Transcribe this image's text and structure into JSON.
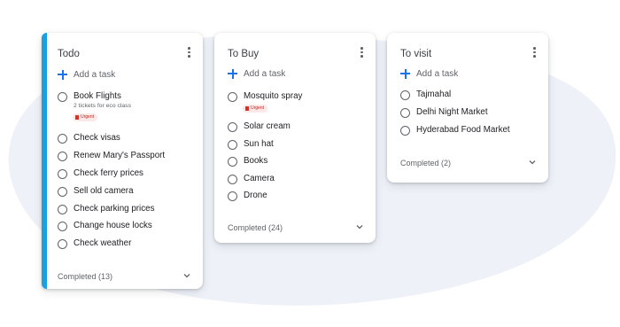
{
  "colors": {
    "accent_bar": "#1a9fe0",
    "add_icon": "#1a73e8",
    "urgent_chip_bg": "#fce8e6",
    "urgent_chip_text": "#c5221f",
    "background_blob": "#eef1f8"
  },
  "icons": {
    "add": "plus-icon",
    "menu": "more-vert-icon",
    "checkbox": "circle-outline-icon",
    "expand": "chevron-down-icon",
    "urgent": "flag-icon"
  },
  "lists": [
    {
      "title": "Todo",
      "add_task": "Add a task",
      "tasks": [
        {
          "label": "Book Flights",
          "sub": "2 tickets for eco class",
          "chip": "Urgent"
        },
        {
          "label": "Check visas"
        },
        {
          "label": "Renew Mary's Passport"
        },
        {
          "label": "Check ferry prices"
        },
        {
          "label": "Sell old camera"
        },
        {
          "label": "Check parking prices"
        },
        {
          "label": "Change house locks"
        },
        {
          "label": "Check weather"
        }
      ],
      "completed": "Completed (13)"
    },
    {
      "title": "To Buy",
      "add_task": "Add a task",
      "tasks": [
        {
          "label": "Mosquito spray",
          "chip": "Urgent"
        },
        {
          "label": "Solar cream"
        },
        {
          "label": "Sun hat"
        },
        {
          "label": "Books"
        },
        {
          "label": "Camera"
        },
        {
          "label": "Drone"
        }
      ],
      "completed": "Completed (24)"
    },
    {
      "title": "To visit",
      "add_task": "Add a task",
      "tasks": [
        {
          "label": "Tajmahal"
        },
        {
          "label": "Delhi Night Market"
        },
        {
          "label": "Hyderabad Food Market"
        }
      ],
      "completed": "Completed (2)"
    }
  ]
}
